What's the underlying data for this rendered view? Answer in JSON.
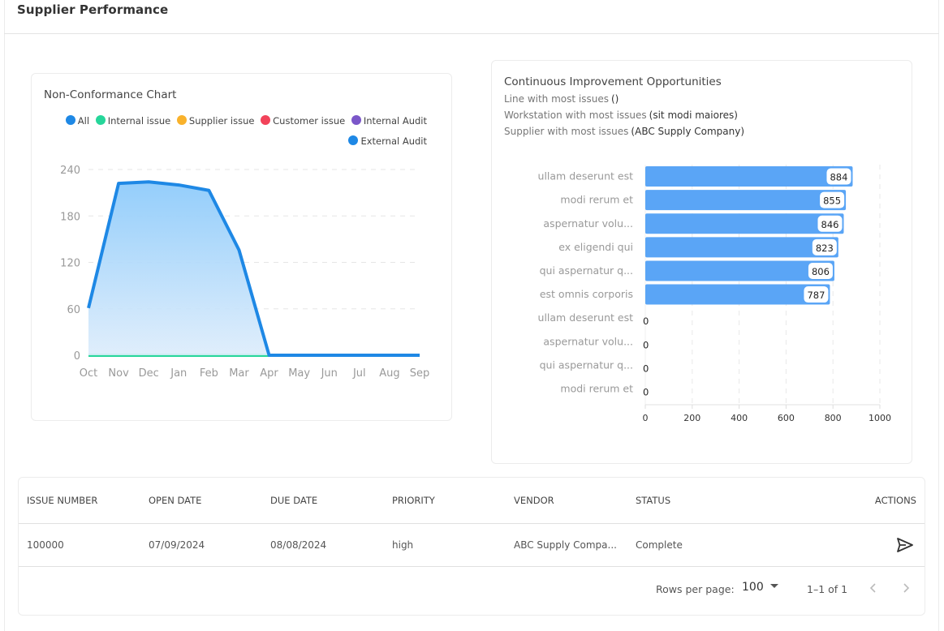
{
  "page": {
    "title": "Supplier Performance"
  },
  "nonconformance": {
    "title": "Non-Conformance Chart",
    "legend": [
      {
        "label": "All",
        "color": "#1e88e5"
      },
      {
        "label": "Internal issue",
        "color": "#26d69a"
      },
      {
        "label": "Supplier issue",
        "color": "#f9b22b"
      },
      {
        "label": "Customer issue",
        "color": "#f2435a"
      },
      {
        "label": "Internal Audit",
        "color": "#7b57c9"
      },
      {
        "label": "External Audit",
        "color": "#1e88e5"
      }
    ]
  },
  "improvement": {
    "title": "Continuous Improvement Opportunities",
    "lines": [
      {
        "label": "Line with most issues",
        "value": "()"
      },
      {
        "label": "Workstation with most issues",
        "value": "(sit modi maiores)"
      },
      {
        "label": "Supplier with most issues",
        "value": "(ABC Supply Company)"
      }
    ]
  },
  "chart_data": [
    {
      "type": "area",
      "title": "Non-Conformance Chart",
      "categories": [
        "Oct",
        "Nov",
        "Dec",
        "Jan",
        "Feb",
        "Mar",
        "Apr",
        "May",
        "Jun",
        "Jul",
        "Aug",
        "Sep"
      ],
      "series": [
        {
          "name": "All",
          "color": "#1e88e5",
          "values": [
            61,
            222,
            224,
            220,
            213,
            136,
            0,
            0,
            0,
            0,
            0,
            0
          ]
        },
        {
          "name": "Internal issue",
          "color": "#26d69a",
          "values": [
            0,
            0,
            0,
            0,
            0,
            0,
            0,
            0,
            0,
            0,
            0,
            0
          ]
        },
        {
          "name": "Supplier issue",
          "color": "#f9b22b",
          "values": [
            0,
            0,
            0,
            0,
            0,
            0,
            0,
            0,
            0,
            0,
            0,
            0
          ]
        },
        {
          "name": "Customer issue",
          "color": "#f2435a",
          "values": [
            0,
            0,
            0,
            0,
            0,
            0,
            0,
            0,
            0,
            0,
            0,
            0
          ]
        },
        {
          "name": "Internal Audit",
          "color": "#7b57c9",
          "values": [
            0,
            0,
            0,
            0,
            0,
            0,
            0,
            0,
            0,
            0,
            0,
            0
          ]
        },
        {
          "name": "External Audit",
          "color": "#1e88e5",
          "values": [
            0,
            0,
            0,
            0,
            0,
            0,
            0,
            0,
            0,
            0,
            0,
            0
          ]
        }
      ],
      "xlabel": "",
      "ylabel": "",
      "ylim": [
        0,
        240
      ],
      "yticks": [
        0,
        60,
        120,
        180,
        240
      ],
      "grid": true,
      "legend": "top-right"
    },
    {
      "type": "bar",
      "orientation": "horizontal",
      "title": "Continuous Improvement Opportunities",
      "categories": [
        "ullam deserunt est",
        "modi rerum et",
        "aspernatur volu...",
        "ex eligendi qui",
        "qui aspernatur q...",
        "est omnis corporis",
        "ullam deserunt est",
        "aspernatur volu...",
        "qui aspernatur q...",
        "modi rerum et"
      ],
      "values": [
        884,
        855,
        846,
        823,
        806,
        787,
        0,
        0,
        0,
        0
      ],
      "color": "#5aa5f6",
      "xlim": [
        0,
        1000
      ],
      "xticks": [
        0,
        200,
        400,
        600,
        800,
        1000
      ],
      "grid": true
    }
  ],
  "table": {
    "columns": [
      "ISSUE NUMBER",
      "OPEN DATE",
      "DUE DATE",
      "PRIORITY",
      "VENDOR",
      "STATUS",
      "ACTIONS"
    ],
    "rows": [
      {
        "issue_number": "100000",
        "open_date": "07/09/2024",
        "due_date": "08/08/2024",
        "priority": "high",
        "vendor": "ABC Supply Compa...",
        "status": "Complete",
        "action_icon": "send-icon"
      }
    ],
    "pagination": {
      "rows_per_page_label": "Rows per page:",
      "rows_per_page": "100",
      "range": "1–1 of 1"
    }
  }
}
